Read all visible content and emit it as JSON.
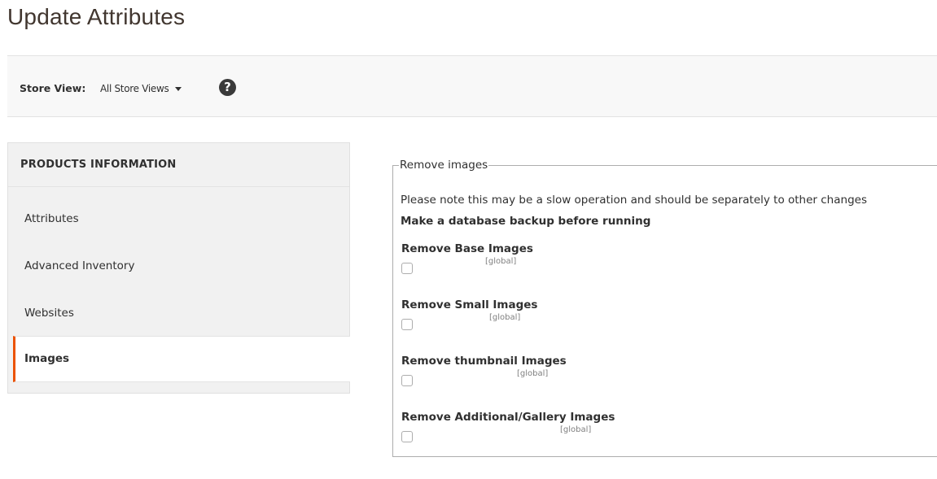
{
  "page": {
    "title": "Update Attributes"
  },
  "store_bar": {
    "label": "Store View:",
    "selected": "All Store Views",
    "help_glyph": "?"
  },
  "sidebar": {
    "title": "PRODUCTS INFORMATION",
    "items": [
      {
        "label": "Attributes",
        "active": false
      },
      {
        "label": "Advanced Inventory",
        "active": false
      },
      {
        "label": "Websites",
        "active": false
      },
      {
        "label": "Images",
        "active": true
      }
    ]
  },
  "remove_images": {
    "legend": "Remove images",
    "note": "Please note this may be a slow operation and should be separately to other changes",
    "warning": "Make a database backup before running",
    "fields": [
      {
        "label": "Remove Base Images",
        "scope": "[global]",
        "checked": false
      },
      {
        "label": "Remove Small Images",
        "scope": "[global]",
        "checked": false
      },
      {
        "label": "Remove thumbnail Images",
        "scope": "[global]",
        "checked": false
      },
      {
        "label": "Remove Additional/Gallery Images",
        "scope": "[global]",
        "checked": false
      }
    ]
  },
  "colors": {
    "accent": "#eb5202",
    "sidebar_bg": "#f1f1f1",
    "bar_bg": "#f8f8f8"
  }
}
